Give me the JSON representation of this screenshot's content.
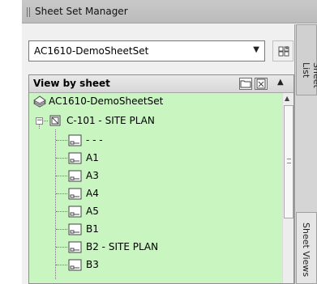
{
  "window": {
    "title": "Sheet Set Manager"
  },
  "combo": {
    "value": "AC1610-DemoSheetSet"
  },
  "tree": {
    "header": "View by sheet",
    "root": {
      "label": "AC1610-DemoSheetSet"
    },
    "subset": {
      "label": "C-101 - SITE PLAN"
    },
    "sheets": [
      {
        "label": "- - -"
      },
      {
        "label": "A1"
      },
      {
        "label": "A3"
      },
      {
        "label": "A4"
      },
      {
        "label": "A5"
      },
      {
        "label": "B1"
      },
      {
        "label": "B2 - SITE PLAN"
      },
      {
        "label": "B3"
      }
    ]
  },
  "side_tabs": [
    {
      "label": "Sheet List"
    },
    {
      "label": "Sheet Views"
    }
  ],
  "colors": {
    "tree_background": "#c8f5c0",
    "titlebar": "#c0c0c0"
  },
  "icons": {
    "combo_side": "sheet-set-properties-icon",
    "header_1": "folder-view-icon",
    "header_2": "sheet-view-icon",
    "root": "sheet-set-icon",
    "subset": "sheet-icon",
    "sheet": "layout-sheet-icon"
  }
}
